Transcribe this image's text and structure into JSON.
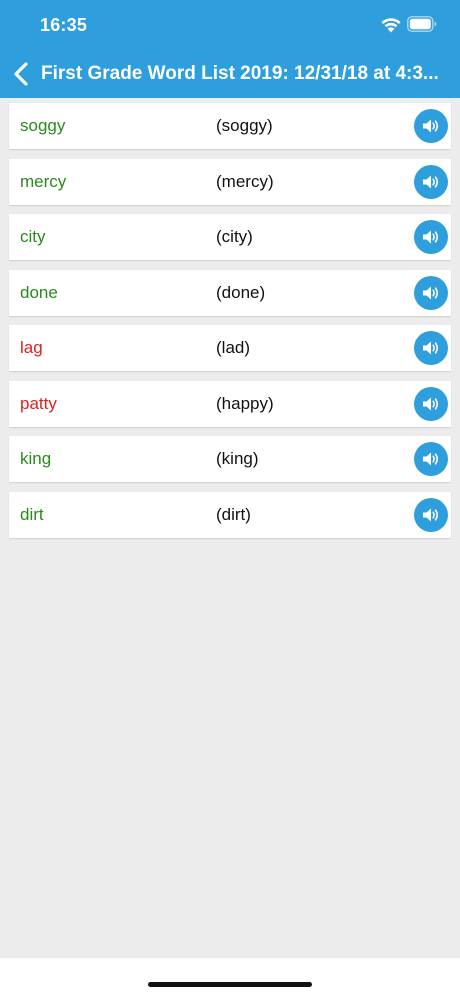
{
  "status_bar": {
    "time": "16:35",
    "wifi_icon": "wifi-icon",
    "battery_icon": "battery-icon"
  },
  "nav": {
    "back_icon": "chevron-left-icon",
    "title": "First Grade Word List 2019: 12/31/18 at 4:3..."
  },
  "colors": {
    "header": "#2e9fdc",
    "correct": "#2a8a1c",
    "incorrect": "#e0211f",
    "background": "#ececec"
  },
  "words": [
    {
      "word": "soggy",
      "heard": "(soggy)",
      "correct": true,
      "icon": "speaker-icon"
    },
    {
      "word": "mercy",
      "heard": "(mercy)",
      "correct": true,
      "icon": "speaker-icon"
    },
    {
      "word": "city",
      "heard": "(city)",
      "correct": true,
      "icon": "speaker-icon"
    },
    {
      "word": "done",
      "heard": "(done)",
      "correct": true,
      "icon": "speaker-icon"
    },
    {
      "word": "lag",
      "heard": "(lad)",
      "correct": false,
      "icon": "speaker-icon"
    },
    {
      "word": "patty",
      "heard": "(happy)",
      "correct": false,
      "icon": "speaker-icon"
    },
    {
      "word": "king",
      "heard": "(king)",
      "correct": true,
      "icon": "speaker-icon"
    },
    {
      "word": "dirt",
      "heard": "(dirt)",
      "correct": true,
      "icon": "speaker-icon"
    }
  ]
}
